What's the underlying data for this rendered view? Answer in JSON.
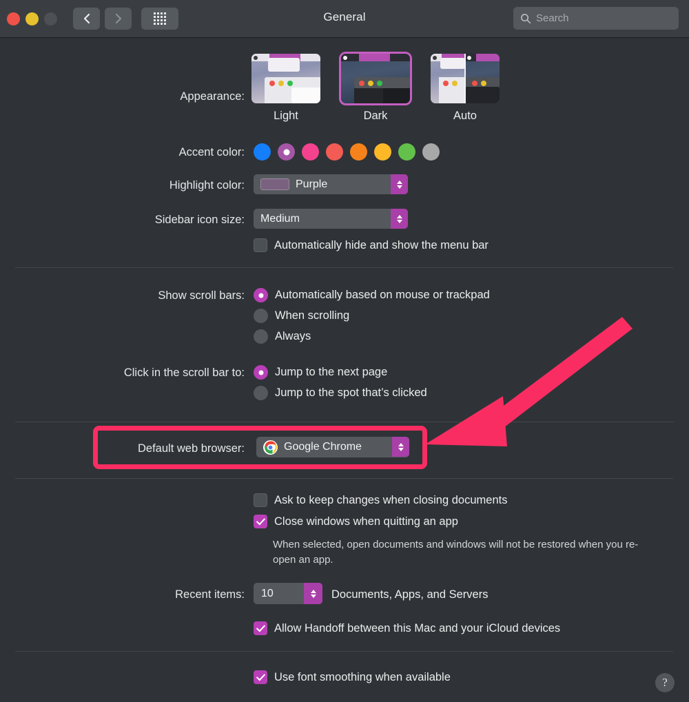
{
  "window": {
    "title": "General",
    "traffic_lights": [
      "close",
      "minimize",
      "zoom"
    ],
    "nav_back": "back",
    "nav_forward": "forward",
    "grid_button": "show-all",
    "help_label": "?"
  },
  "search": {
    "placeholder": "Search",
    "value": ""
  },
  "appearance": {
    "label": "Appearance:",
    "options": [
      {
        "label": "Light",
        "selected": false
      },
      {
        "label": "Dark",
        "selected": true
      },
      {
        "label": "Auto",
        "selected": false
      }
    ]
  },
  "accent_color": {
    "label": "Accent color:",
    "selected_index": 1,
    "swatches": [
      {
        "name": "blue",
        "hex": "#147efb"
      },
      {
        "name": "purple",
        "hex": "#a556a7"
      },
      {
        "name": "pink",
        "hex": "#f4428e"
      },
      {
        "name": "red",
        "hex": "#f35b55"
      },
      {
        "name": "orange",
        "hex": "#f7821b"
      },
      {
        "name": "yellow",
        "hex": "#fcb827"
      },
      {
        "name": "green",
        "hex": "#63c14b"
      },
      {
        "name": "graphite",
        "hex": "#a8a8a8"
      }
    ]
  },
  "highlight_color": {
    "label": "Highlight color:",
    "value": "Purple",
    "swatch_hex": "#7b6180"
  },
  "sidebar_icon_size": {
    "label": "Sidebar icon size:",
    "value": "Medium"
  },
  "menu_bar": {
    "label": "Automatically hide and show the menu bar",
    "checked": false
  },
  "show_scroll_bars": {
    "label": "Show scroll bars:",
    "options": [
      {
        "label": "Automatically based on mouse or trackpad",
        "selected": true
      },
      {
        "label": "When scrolling",
        "selected": false
      },
      {
        "label": "Always",
        "selected": false
      }
    ]
  },
  "click_scroll_bar": {
    "label": "Click in the scroll bar to:",
    "options": [
      {
        "label": "Jump to the next page",
        "selected": true
      },
      {
        "label": "Jump to the spot that’s clicked",
        "selected": false
      }
    ]
  },
  "default_browser": {
    "label": "Default web browser:",
    "value": "Google Chrome",
    "icon": "chrome-icon",
    "highlighted": true,
    "highlight_hex": "#fa2d62"
  },
  "document_options": [
    {
      "label": "Ask to keep changes when closing documents",
      "checked": false
    },
    {
      "label": "Close windows when quitting an app",
      "checked": true
    }
  ],
  "close_windows_help": "When selected, open documents and windows will not be restored when you re-open an app.",
  "recent_items": {
    "label": "Recent items:",
    "value": "10",
    "suffix": "Documents, Apps, and Servers"
  },
  "handoff": {
    "label": "Allow Handoff between this Mac and your iCloud devices",
    "checked": true
  },
  "font_smoothing": {
    "label": "Use font smoothing when available",
    "checked": true
  },
  "annotation": {
    "arrow_hex": "#fa2d62",
    "box_hex": "#fa2d62"
  }
}
